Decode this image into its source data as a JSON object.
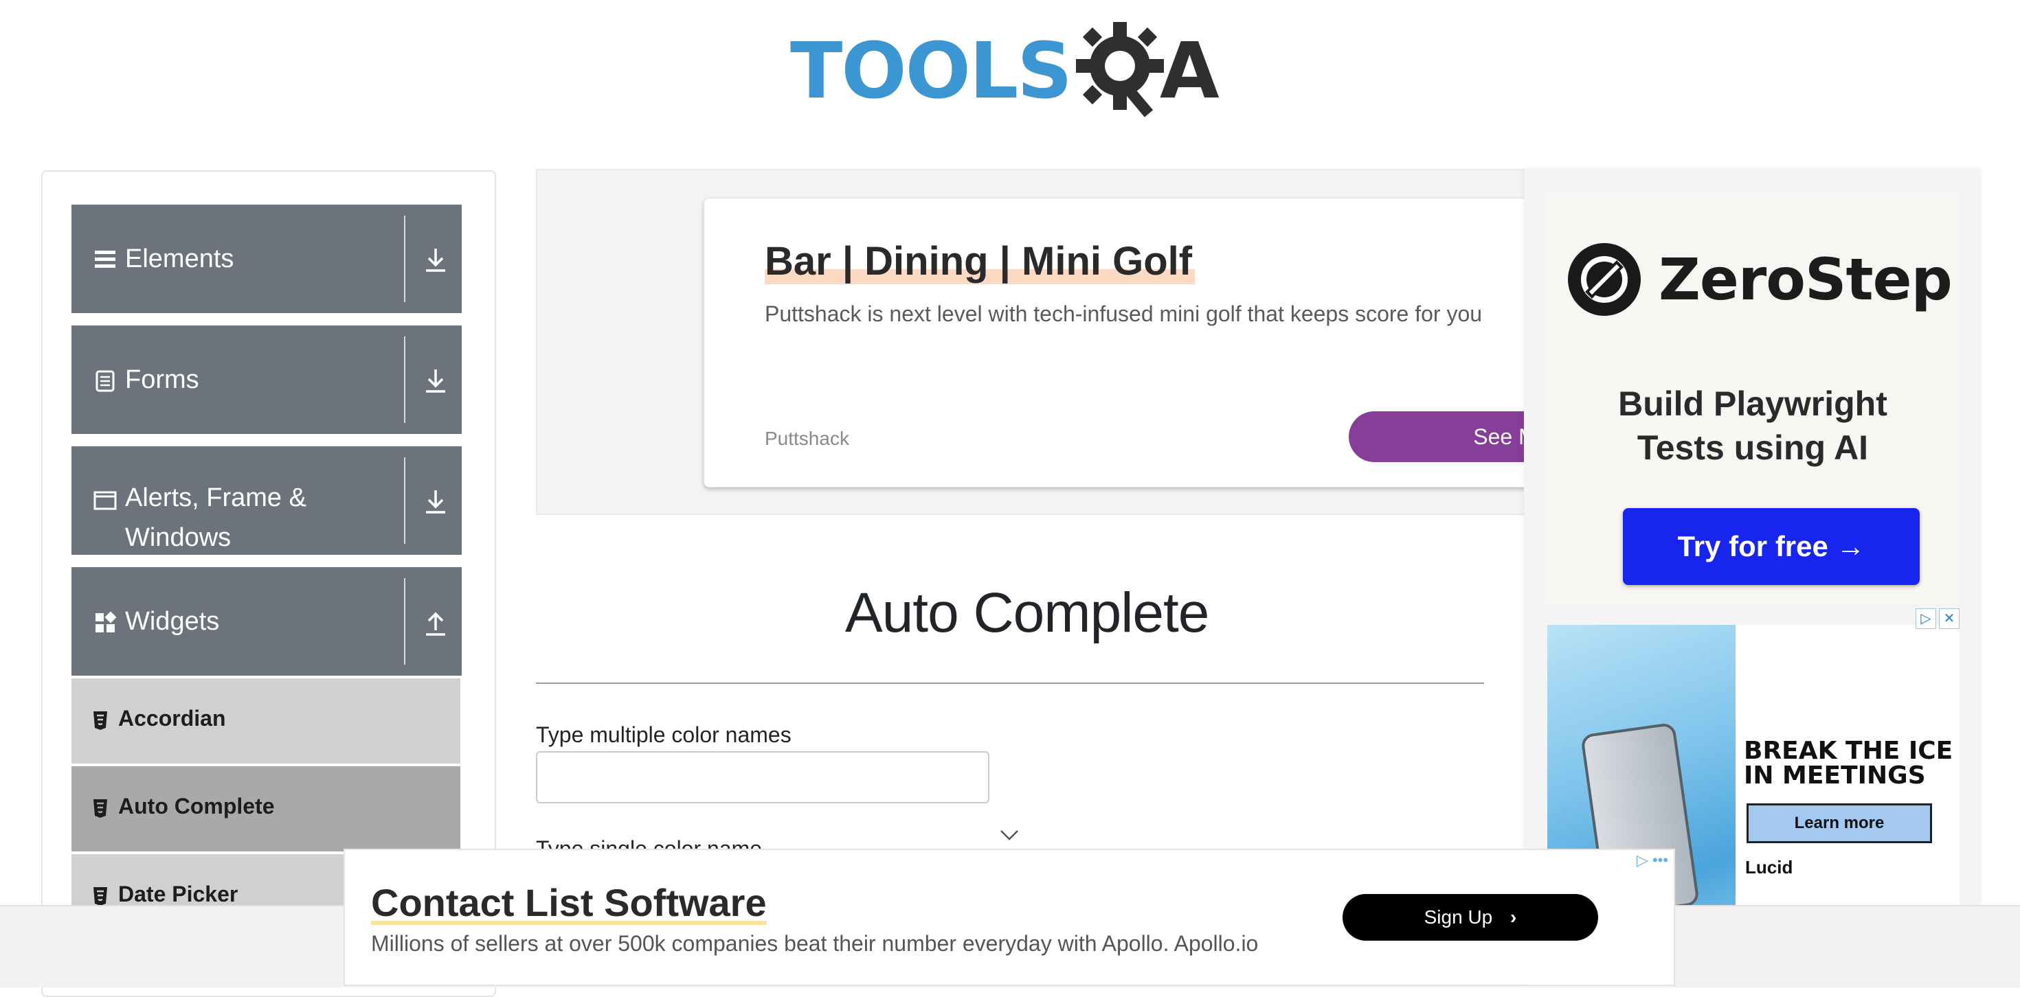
{
  "logo": {
    "text_left": "TOOLS",
    "text_right": "A"
  },
  "sidebar": {
    "groups": [
      {
        "label": "Elements",
        "icon": "hamburger-icon",
        "arrow": "download-arrow-icon"
      },
      {
        "label": "Forms",
        "icon": "document-icon",
        "arrow": "download-arrow-icon"
      },
      {
        "label": "Alerts, Frame & Windows",
        "icon": "window-icon",
        "arrow": "download-arrow-icon"
      },
      {
        "label": "Widgets",
        "icon": "widgets-icon",
        "arrow": "upload-arrow-icon"
      }
    ],
    "items": [
      {
        "label": "Accordian",
        "active": false
      },
      {
        "label": "Auto Complete",
        "active": true
      },
      {
        "label": "Date Picker",
        "active": false
      }
    ]
  },
  "ad_top": {
    "title": "Bar | Dining | Mini Golf",
    "description": "Puttshack is next level with tech-infused mini golf that keeps score for you",
    "brand": "Puttshack",
    "button": "See More"
  },
  "ad_side": {
    "brand": "ZeroStep",
    "tagline_line1": "Build Playwright",
    "tagline_line2": "Tests using AI",
    "button": "Try for free →",
    "lucid_headline_line1": "BREAK THE ICE",
    "lucid_headline_line2": "IN MEETINGS",
    "lucid_button": "Learn more",
    "lucid_brand": "Lucid"
  },
  "main": {
    "title": "Auto Complete",
    "multi_label": "Type multiple color names",
    "multi_value": "",
    "single_label": "Type single color name"
  },
  "ad_bottom": {
    "title": "Contact List Software",
    "description": "Millions of sellers at over 500k companies beat their number everyday with Apollo. Apollo.io",
    "button": "Sign Up"
  },
  "colors": {
    "sidebar_group": "#6c737c",
    "sidebar_item": "#d0d0d0",
    "sidebar_item_active": "#a9a9a9",
    "accent_purple": "#873e98",
    "accent_blue": "#1725ef",
    "logo_blue": "#3c96d2"
  }
}
